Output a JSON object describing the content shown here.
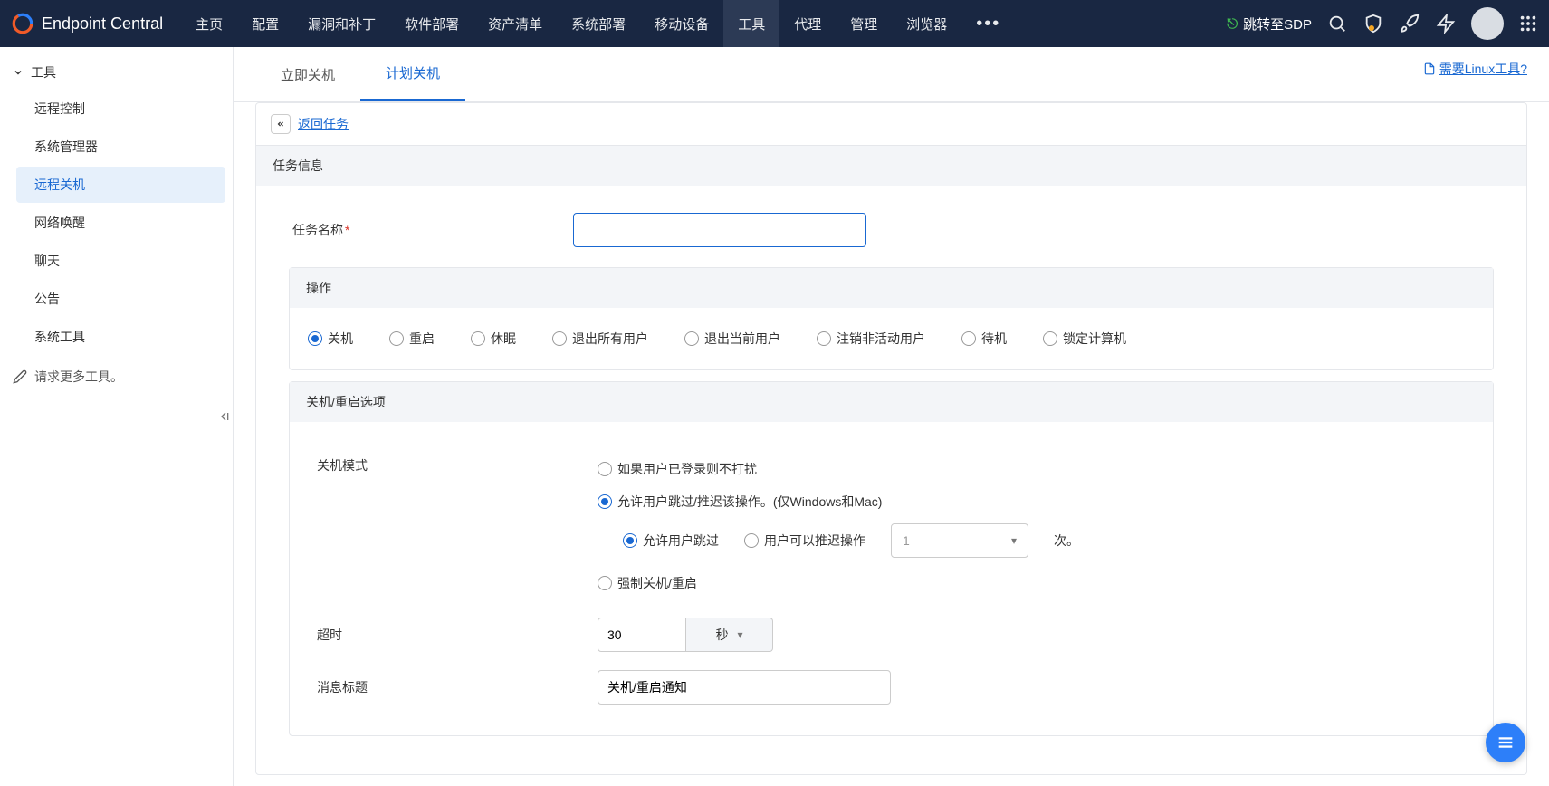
{
  "brand": "Endpoint Central",
  "nav": {
    "home": "主页",
    "config": "配置",
    "patch": "漏洞和补丁",
    "software": "软件部署",
    "inventory": "资产清单",
    "osdeploy": "系统部署",
    "mobile": "移动设备",
    "tools": "工具",
    "agent": "代理",
    "admin": "管理",
    "browser": "浏览器"
  },
  "sdp_link": "跳转至SDP",
  "sidebar": {
    "group": "工具",
    "items": [
      "远程控制",
      "系统管理器",
      "远程关机",
      "网络唤醒",
      "聊天",
      "公告",
      "系统工具"
    ],
    "request_more": "请求更多工具。"
  },
  "tabs": {
    "now": "立即关机",
    "scheduled": "计划关机"
  },
  "linux_link": "需要Linux工具?",
  "back_link": "返回任务",
  "sections": {
    "task_info": "任务信息",
    "operation": "操作",
    "shutdown_options": "关机/重启选项"
  },
  "form": {
    "task_name_label": "任务名称",
    "task_name_value": "",
    "operations": [
      "关机",
      "重启",
      "休眠",
      "退出所有用户",
      "退出当前用户",
      "注销非活动用户",
      "待机",
      "锁定计算机"
    ],
    "shutdown_mode_label": "关机模式",
    "mode_options": {
      "dnd": "如果用户已登录则不打扰",
      "allow_skip_delay": "允许用户跳过/推迟该操作。(仅Windows和Mac)",
      "force": "强制关机/重启"
    },
    "sub_mode": {
      "allow_skip": "允许用户跳过",
      "user_can_delay": "用户可以推迟操作",
      "delay_count": "1",
      "times_suffix": "次。"
    },
    "timeout_label": "超时",
    "timeout_value": "30",
    "timeout_unit": "秒",
    "message_title_label": "消息标题",
    "message_title_value": "关机/重启通知"
  }
}
